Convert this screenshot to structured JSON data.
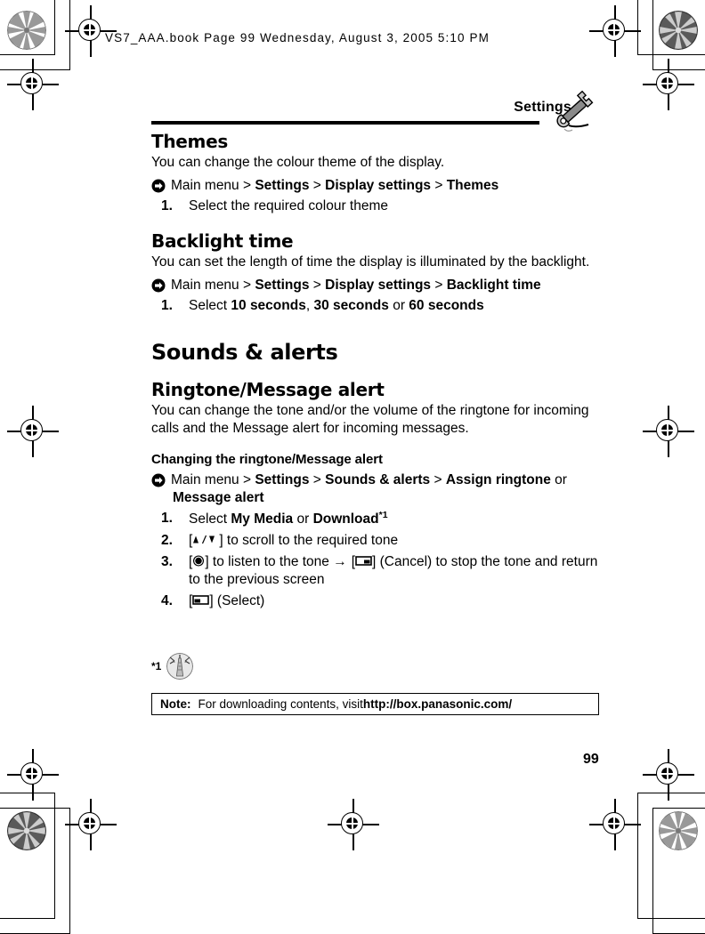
{
  "file_header": "VS7_AAA.book  Page 99  Wednesday, August 3, 2005  5:10 PM",
  "running_head": "Settings",
  "header_icon": "wrench-icon",
  "page_number": "99",
  "sections": [
    {
      "id": "themes",
      "heading": "Themes",
      "body": "You can change the colour theme of the display.",
      "menu_path": {
        "icon": "menu-path-arrow-icon",
        "prefix": "Main menu > ",
        "parts": [
          "Settings",
          "Display settings",
          "Themes"
        ],
        "separator": " > "
      },
      "steps": [
        {
          "num": "1.",
          "text_before": "Select the required colour theme"
        }
      ]
    },
    {
      "id": "backlight-time",
      "heading": "Backlight time",
      "body": "You can set the length of time the display is illuminated by the backlight.",
      "menu_path": {
        "icon": "menu-path-arrow-icon",
        "prefix": "Main menu > ",
        "parts": [
          "Settings",
          "Display settings",
          "Backlight time"
        ],
        "separator": " > "
      },
      "steps": [
        {
          "num": "1.",
          "text_before": "Select ",
          "bold1": "10 seconds",
          "mid1": ", ",
          "bold2": "30 seconds",
          "mid2": " or ",
          "bold3": "60 seconds"
        }
      ]
    }
  ],
  "chapter": {
    "heading": "Sounds & alerts",
    "subsection": {
      "heading": "Ringtone/Message alert",
      "body": "You can change the tone and/or the volume of the ringtone for incoming calls and the Message alert for incoming messages.",
      "subsubsection": {
        "heading": "Changing the ringtone/Message alert",
        "menu_path": {
          "icon": "menu-path-arrow-icon",
          "prefix": "Main menu > ",
          "parts": [
            "Settings",
            "Sounds & alerts",
            "Assign ringtone"
          ],
          "separator": " > ",
          "suffix": " or",
          "continuation": "Message alert"
        },
        "steps": [
          {
            "num": "1.",
            "lead": "Select ",
            "bold1": "My Media",
            "mid": " or ",
            "bold2": "Download",
            "footnote_marker": "*1"
          },
          {
            "num": "2.",
            "key_icon": "updown-navigation-key-icon",
            "key_open": "[",
            "key_close": "]",
            "text": " to scroll to the required tone"
          },
          {
            "num": "3.",
            "key_icon": "center-select-key-icon",
            "key_open": "[",
            "key_close": "]",
            "text_a": " to listen to the tone ",
            "arrow": "→",
            "key_icon_2": "right-softkey-icon",
            "text_b": " (Cancel) to stop the tone and return to the previous screen"
          },
          {
            "num": "4.",
            "key_icon": "left-softkey-icon",
            "key_open": "[",
            "key_close": "]",
            "text": " (Select)"
          }
        ]
      }
    }
  },
  "footnote": {
    "marker": "*1",
    "icon": "broadcast-tower-icon"
  },
  "note": {
    "label": "Note:",
    "text": "For downloading contents, visit ",
    "url": "http://box.panasonic.com/"
  },
  "colors": {
    "ink": "#000000",
    "paper": "#ffffff"
  }
}
